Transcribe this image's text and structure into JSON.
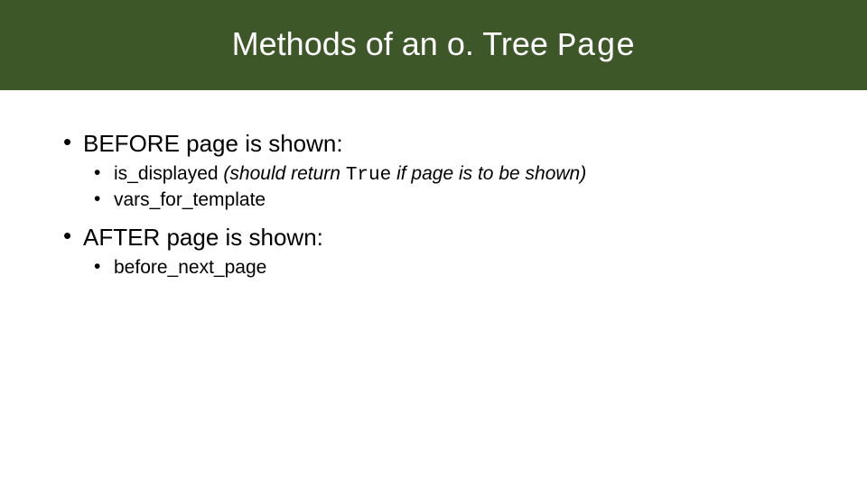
{
  "title": {
    "prefix": "Methods of an o. Tree ",
    "code": "Page"
  },
  "sections": [
    {
      "heading": "BEFORE page is shown:",
      "items": [
        {
          "name": "is_displayed",
          "note_prefix": " (should return ",
          "note_code": "True",
          "note_suffix": " if page is to be shown)"
        },
        {
          "name": "vars_for_template"
        }
      ]
    },
    {
      "heading": "AFTER page is shown:",
      "items": [
        {
          "name": "before_next_page"
        }
      ]
    }
  ]
}
